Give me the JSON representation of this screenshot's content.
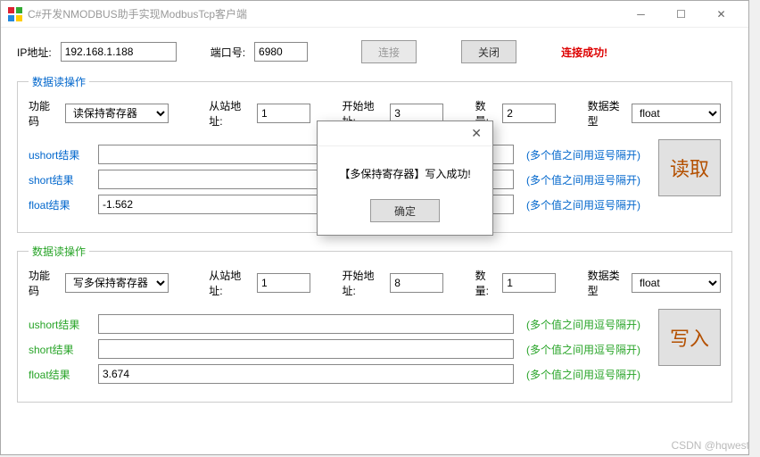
{
  "titlebar": {
    "title": "C#开发NMODBUS助手实现ModbusTcp客户端"
  },
  "top": {
    "ip_label": "IP地址:",
    "ip_value": "192.168.1.188",
    "port_label": "端口号:",
    "port_value": "6980",
    "connect_label": "连接",
    "close_label": "关闭",
    "status": "连接成功!"
  },
  "read": {
    "legend": "数据读操作",
    "func_label": "功能码",
    "func_value": "读保持寄存器",
    "slave_label": "从站地址:",
    "slave_value": "1",
    "start_label": "开始地址:",
    "start_value": "3",
    "count_label": "数量:",
    "count_value": "2",
    "dtype_label": "数据类型",
    "dtype_value": "float",
    "ushort_label": "ushort结果",
    "ushort_value": "",
    "short_label": "short结果",
    "short_value": "",
    "float_label": "float结果",
    "float_value": "-1.562",
    "hint": "(多个值之间用逗号隔开)",
    "button": "读取"
  },
  "write": {
    "legend": "数据读操作",
    "func_label": "功能码",
    "func_value": "写多保持寄存器",
    "slave_label": "从站地址:",
    "slave_value": "1",
    "start_label": "开始地址:",
    "start_value": "8",
    "count_label": "数量:",
    "count_value": "1",
    "dtype_label": "数据类型",
    "dtype_value": "float",
    "ushort_label": "ushort结果",
    "ushort_value": "",
    "short_label": "short结果",
    "short_value": "",
    "float_label": "float结果",
    "float_value": "3.674",
    "hint": "(多个值之间用逗号隔开)",
    "button": "写入"
  },
  "dialog": {
    "message": "【多保持寄存器】写入成功!",
    "ok": "确定"
  },
  "watermark": "CSDN @hqwest"
}
